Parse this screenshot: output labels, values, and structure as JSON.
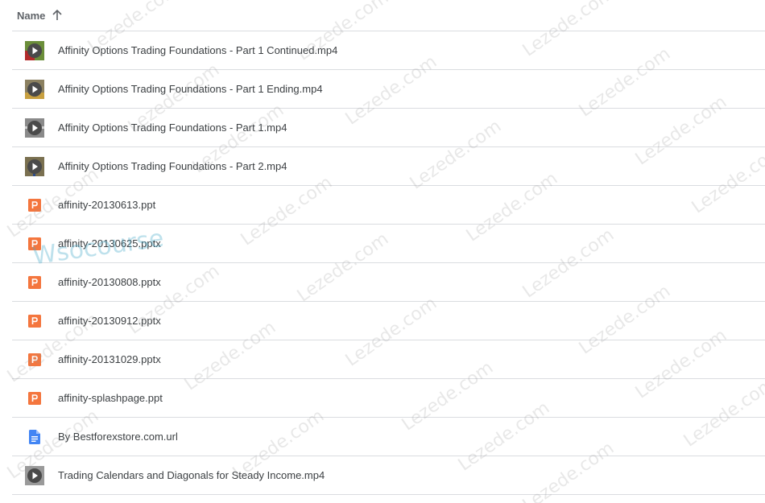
{
  "header": {
    "name_label": "Name",
    "sort_icon": "arrow-up-icon"
  },
  "files": [
    {
      "name": "Affinity Options Trading Foundations - Part 1 Continued.mp4",
      "icon": "video-icon"
    },
    {
      "name": "Affinity Options Trading Foundations - Part 1 Ending.mp4",
      "icon": "video-icon"
    },
    {
      "name": "Affinity Options Trading Foundations - Part 1.mp4",
      "icon": "video-icon"
    },
    {
      "name": "Affinity Options Trading Foundations - Part 2.mp4",
      "icon": "video-icon"
    },
    {
      "name": "affinity-20130613.ppt",
      "icon": "powerpoint-icon"
    },
    {
      "name": "affinity-20130625.pptx",
      "icon": "powerpoint-icon"
    },
    {
      "name": "affinity-20130808.pptx",
      "icon": "powerpoint-icon"
    },
    {
      "name": "affinity-20130912.pptx",
      "icon": "powerpoint-icon"
    },
    {
      "name": "affinity-20131029.pptx",
      "icon": "powerpoint-icon"
    },
    {
      "name": "affinity-splashpage.ppt",
      "icon": "powerpoint-icon"
    },
    {
      "name": "By Bestforexstore.com.url",
      "icon": "document-icon"
    },
    {
      "name": "Trading Calendars and Diagonals for Steady Income.mp4",
      "icon": "video-icon"
    }
  ],
  "watermarks": {
    "text": "Lezede.com",
    "overlay_text": "Wsocourse"
  },
  "colors": {
    "powerpoint": "#f4763e",
    "document": "#4285f4",
    "video_circle": "#5f6368",
    "divider": "#dadce0"
  }
}
